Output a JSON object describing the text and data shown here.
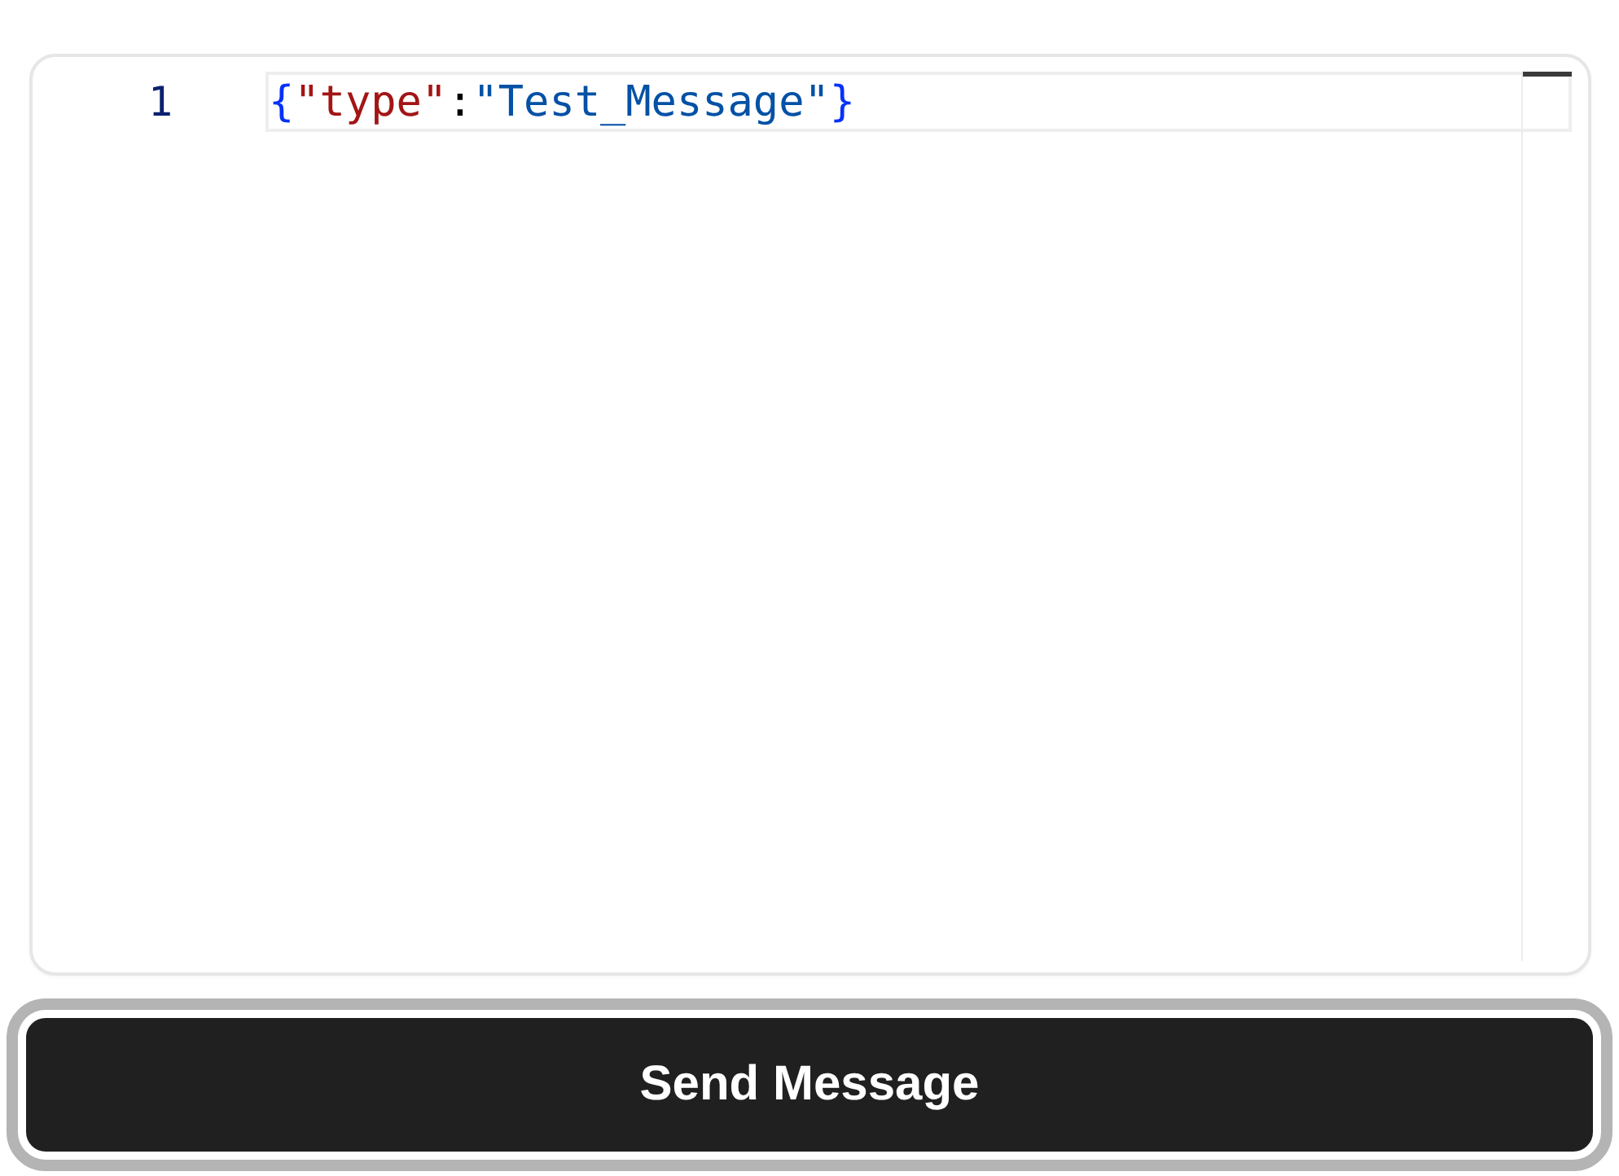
{
  "editor": {
    "lines": [
      {
        "number": "1",
        "current": true,
        "tokens": [
          {
            "text": "{",
            "color": "#0431fa"
          },
          {
            "text": "\"type\"",
            "color": "#a31515"
          },
          {
            "text": ":",
            "color": "#000000"
          },
          {
            "text": "\"Test_Message\"",
            "color": "#0451a5"
          },
          {
            "text": "}",
            "color": "#0431fa"
          }
        ]
      }
    ]
  },
  "button": {
    "label": "Send Message",
    "focused": true
  }
}
